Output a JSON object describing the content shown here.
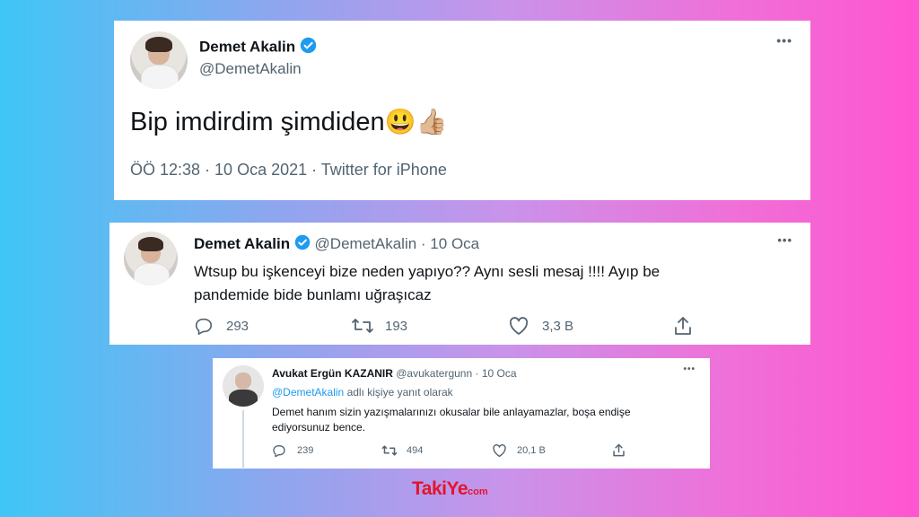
{
  "tweet1": {
    "name": "Demet Akalin",
    "handle": "@DemetAkalin",
    "text": "Bip imdirdim şimdiden",
    "emoji": "😃👍🏼",
    "meta": "ÖÖ 12:38 · 10 Oca 2021 · Twitter for iPhone",
    "more": "•••"
  },
  "tweet2": {
    "name": "Demet Akalin",
    "handle": "@DemetAkalin",
    "date": "· 10 Oca",
    "text_line1": "Wtsup bu işkenceyi bize neden yapıyo?? Aynı sesli mesaj !!!! Ayıp be",
    "text_line2": "pandemide bide bunlamı uğraşıcaz",
    "replies": "293",
    "retweets": "193",
    "likes": "3,3 B",
    "more": "•••"
  },
  "tweet3": {
    "name": "Avukat Ergün KAZANIR",
    "handle": "@avukatergunn",
    "date": "· 10 Oca",
    "reply_to_handle": "@DemetAkalin",
    "reply_to_text": "adlı kişiye yanıt olarak",
    "text_line1": "Demet hanım sizin yazışmalarınızı okusalar bile anlayamazlar, boşa endişe",
    "text_line2": "ediyorsunuz bence.",
    "replies": "239",
    "retweets": "494",
    "likes": "20,1 B",
    "more": "•••"
  },
  "brand": {
    "part1": "Taki",
    "part2": "Ye",
    "suffix": "com",
    "colors": {
      "red": "#e3142d",
      "yellow": "#f5c400"
    }
  },
  "colors": {
    "verified": "#1d9bf0",
    "muted": "#536471"
  }
}
